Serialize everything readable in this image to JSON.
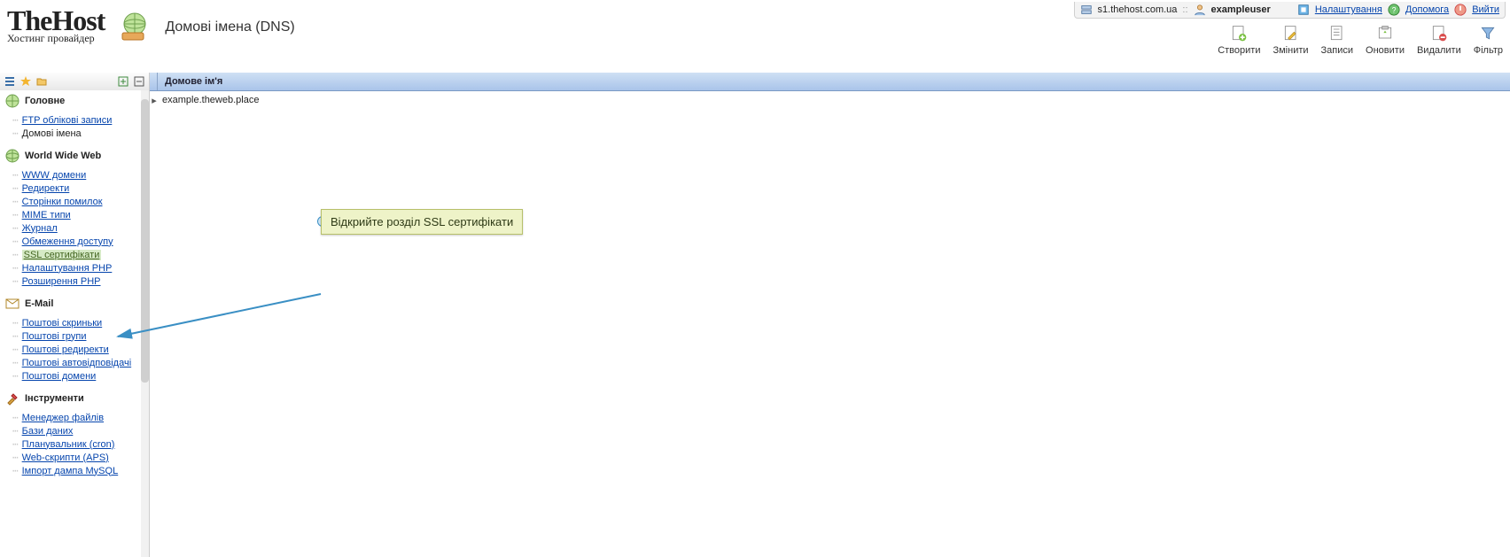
{
  "topbar": {
    "server": "s1.thehost.com.ua",
    "separator": "::",
    "user": "exampleuser",
    "settings": "Налаштування",
    "help": "Допомога",
    "logout": "Вийти"
  },
  "brand": {
    "line1": "TheHost",
    "line2": "Хостинг провайдер"
  },
  "page_title": "Домові імена (DNS)",
  "toolbar": {
    "create": "Створити",
    "edit": "Змінити",
    "records": "Записи",
    "refresh": "Оновити",
    "delete": "Видалити",
    "filter": "Фільтр"
  },
  "column_header": "Домове ім'я",
  "rows": [
    {
      "domain": "example.theweb.place"
    }
  ],
  "callout_text": "Відкрийте розділ SSL сертифікати",
  "sidebar": {
    "groups": [
      {
        "icon": "home-icon",
        "title": "Головне",
        "items": [
          {
            "label": "FTP облікові записи",
            "link": true
          },
          {
            "label": "Домові імена",
            "link": false
          }
        ]
      },
      {
        "icon": "globe-icon",
        "title": "World Wide Web",
        "items": [
          {
            "label": "WWW домени",
            "link": true
          },
          {
            "label": "Редиректи",
            "link": true
          },
          {
            "label": "Сторінки помилок",
            "link": true
          },
          {
            "label": "MIME типи",
            "link": true
          },
          {
            "label": "Журнал",
            "link": true
          },
          {
            "label": "Обмеження доступу",
            "link": true
          },
          {
            "label": "SSL сертифікати",
            "link": true,
            "highlight": true
          },
          {
            "label": "Налаштування PHP",
            "link": true
          },
          {
            "label": "Розширення PHP",
            "link": true
          }
        ]
      },
      {
        "icon": "mail-icon",
        "title": "E-Mail",
        "items": [
          {
            "label": "Поштові скриньки",
            "link": true
          },
          {
            "label": "Поштові групи",
            "link": true
          },
          {
            "label": "Поштові редиректи",
            "link": true
          },
          {
            "label": "Поштові автовідповідачі",
            "link": true
          },
          {
            "label": "Поштові домени",
            "link": true
          }
        ]
      },
      {
        "icon": "tools-icon",
        "title": "Інструменти",
        "items": [
          {
            "label": "Менеджер файлів",
            "link": true
          },
          {
            "label": "Бази даних",
            "link": true
          },
          {
            "label": "Планувальник (cron)",
            "link": true
          },
          {
            "label": "Web-скрипти (APS)",
            "link": true
          },
          {
            "label": "Імпорт дампа MySQL",
            "link": true
          }
        ]
      }
    ]
  }
}
